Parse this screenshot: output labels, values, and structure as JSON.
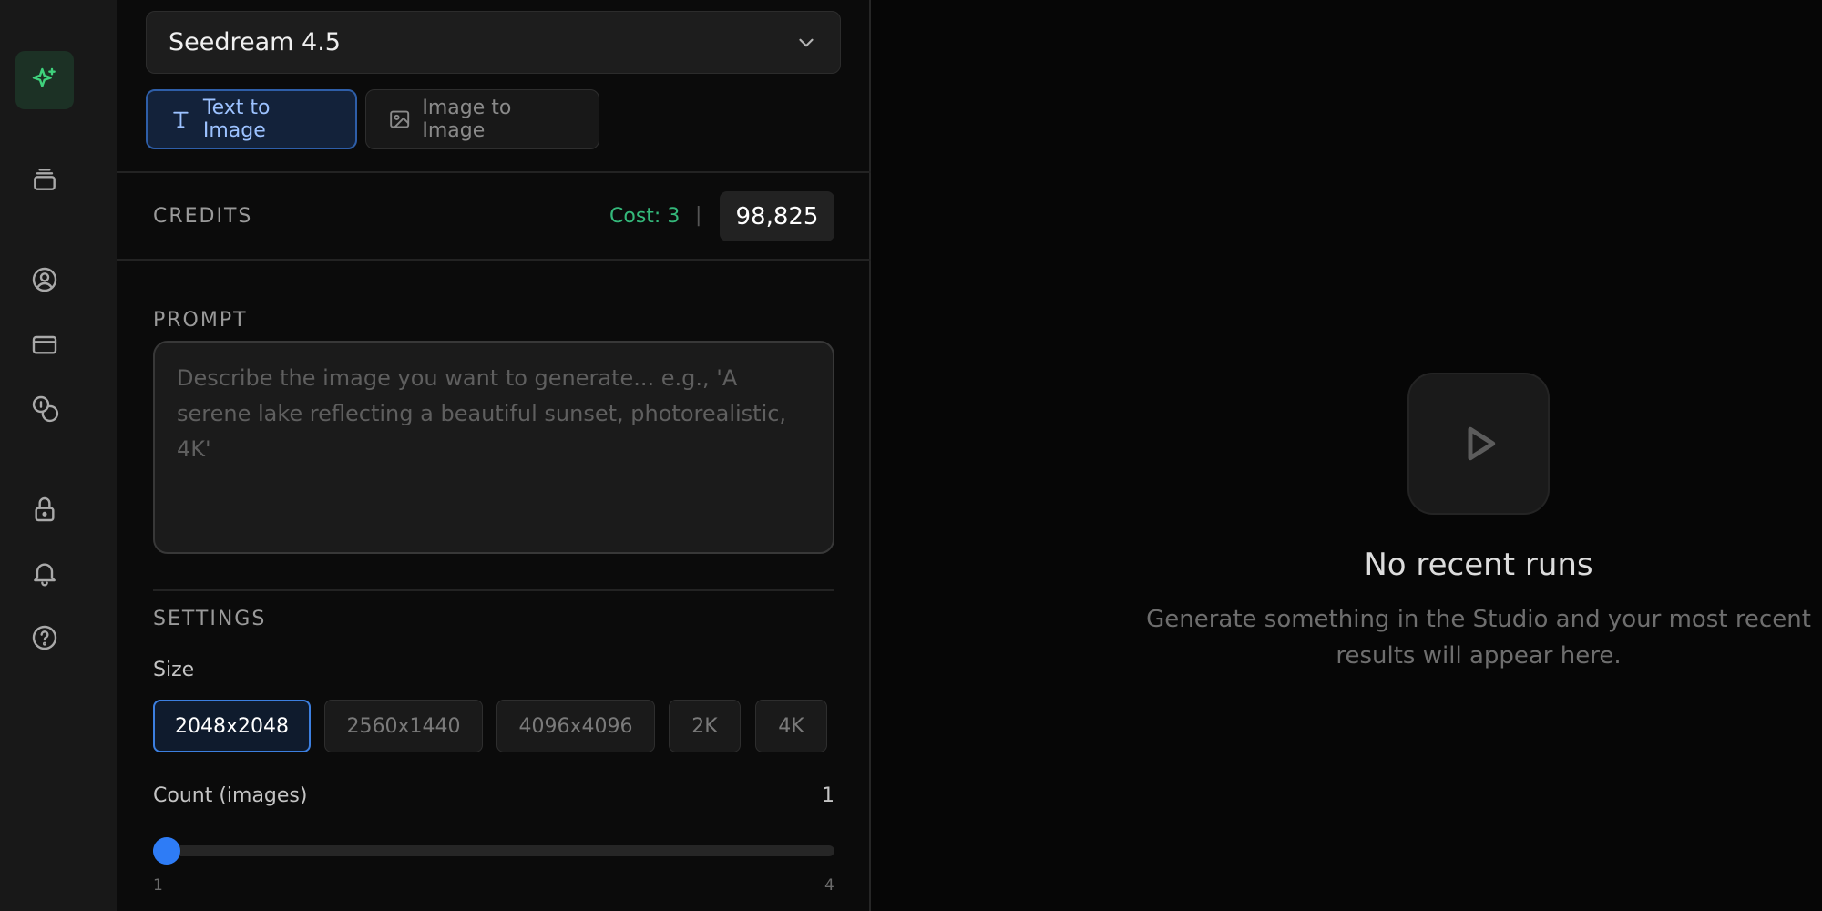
{
  "rail": {
    "items": [
      {
        "icon": "sparkles-icon",
        "active": true
      },
      {
        "icon": "layers-icon",
        "active": false
      },
      {
        "icon": "user-circle-icon",
        "active": false
      },
      {
        "icon": "credit-card-icon",
        "active": false
      },
      {
        "icon": "coins-icon",
        "active": false
      },
      {
        "icon": "lock-icon",
        "active": false
      },
      {
        "icon": "bell-icon",
        "active": false
      },
      {
        "icon": "help-circle-icon",
        "active": false
      }
    ]
  },
  "model": {
    "selected": "Seedream 4.5"
  },
  "modes": {
    "text_to_image": "Text to Image",
    "image_to_image": "Image to Image",
    "active": "Text to Image"
  },
  "credits": {
    "title": "CREDITS",
    "cost": "Cost: 3",
    "separator": "|",
    "balance": "98,825"
  },
  "prompt": {
    "title": "PROMPT",
    "value": "",
    "placeholder": "Describe the image you want to generate... e.g., 'A serene lake reflecting a beautiful sunset, photorealistic, 4K'"
  },
  "settings": {
    "title": "SETTINGS",
    "size_label": "Size",
    "sizes": [
      "2048x2048",
      "2560x1440",
      "4096x4096",
      "2K",
      "4K"
    ],
    "selected_size": "2048x2048",
    "count_label": "Count (images)",
    "count_value": "1",
    "count_min": "1",
    "count_max": "4",
    "count_level_fraction": 0.0
  },
  "empty_state": {
    "icon": "play-icon",
    "title": "No recent runs",
    "description": "Generate something in the Studio and your most recent results will appear here."
  },
  "colors": {
    "accent_blue": "#2e7cf6",
    "accent_green": "#34b87a",
    "background": "#060606"
  }
}
